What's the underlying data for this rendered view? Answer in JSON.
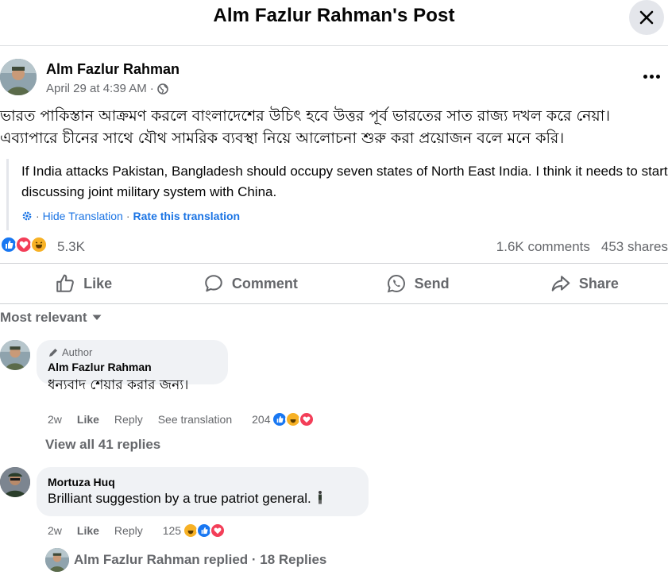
{
  "header": {
    "title": "Alm Fazlur Rahman's Post"
  },
  "post": {
    "author": "Alm Fazlur Rahman",
    "date": "April 29 at 4:39 AM",
    "separator": "·",
    "text_line1": "ভারত পাকিস্তান আক্রমণ করলে বাংলাদেশের উচিৎ হবে উত্তর পূর্ব  ভারতের সাত রাজ্য দখল করে নেয়া।",
    "text_line2": "এব্যাপারে চীনের সাথে যৌথ সামরিক ব্যবস্থা নিয়ে আলোচনা শুরু করা প্রয়োজন বলে মনে করি।",
    "translation": "If India attacks Pakistan, Bangladesh should occupy seven states of North East India. I think it needs to start discussing joint military system with China.",
    "hide_translation": "Hide Translation",
    "rate_translation": "Rate this translation"
  },
  "stats": {
    "reactions": "5.3K",
    "comments": "1.6K comments",
    "shares": "453 shares"
  },
  "actions": {
    "like": "Like",
    "comment": "Comment",
    "send": "Send",
    "share": "Share"
  },
  "sort": {
    "label": "Most relevant"
  },
  "comments": [
    {
      "badge": "Author",
      "name": "Alm Fazlur Rahman",
      "text": "ধন্যবাদ শেয়ার করার জন্য।",
      "time": "2w",
      "like": "Like",
      "reply": "Reply",
      "see_translation": "See translation",
      "reactions": "204"
    },
    {
      "name": "Mortuza Huq",
      "text": "Brilliant suggestion by a true patriot general.",
      "time": "2w",
      "like": "Like",
      "reply": "Reply",
      "reactions": "125"
    }
  ],
  "view_replies": "View all 41 replies",
  "replied": "Alm Fazlur Rahman replied · 18 Replies",
  "colors": {
    "like_blue": "#1877f2",
    "love_red": "#f33e58",
    "haha_yellow": "#f7b125",
    "link_blue": "#1b74e4"
  }
}
